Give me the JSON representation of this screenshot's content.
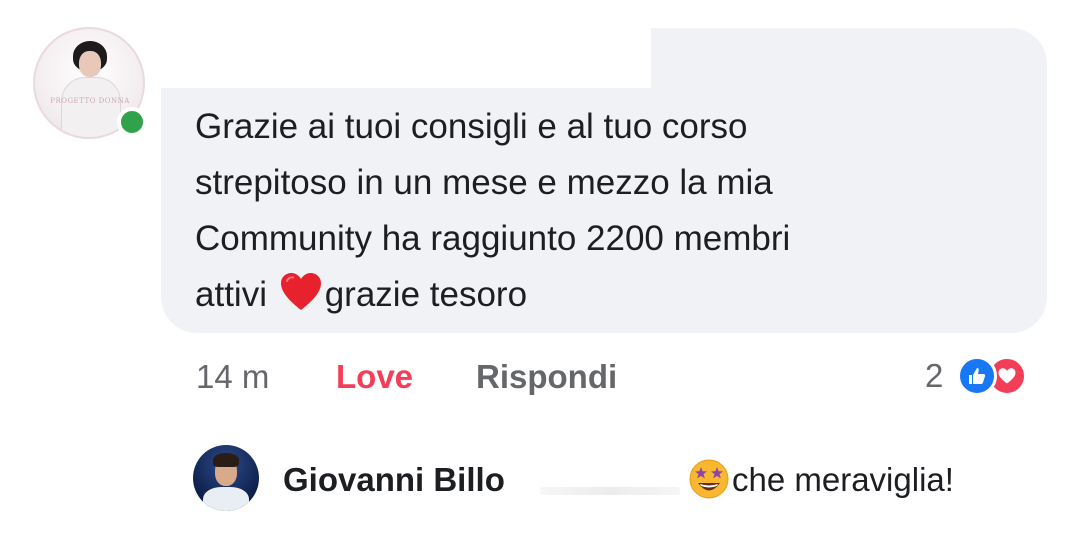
{
  "comment": {
    "author_avatar_label": "PROGETTO DONNA",
    "text_before_heart": "Grazie ai tuoi consigli e al tuo corso\nstrepitoso in un mese e mezzo la mia\nCommunity ha raggiunto 2200 membri\nattivi ",
    "text_after_heart": "grazie tesoro",
    "heart_icon": "red-heart-emoji",
    "online_status_color": "#31a24c",
    "bubble_color": "#f0f2f5"
  },
  "actions": {
    "timestamp": "14 m",
    "love_label": "Love",
    "love_color": "#f33e58",
    "reply_label": "Rispondi"
  },
  "reactions": {
    "count": "2",
    "icons": [
      "like-icon",
      "love-icon"
    ],
    "like_color": "#1877f2",
    "love_color": "#f33e58"
  },
  "reply": {
    "author": "Giovanni Billo",
    "emoji_icon": "star-struck-emoji",
    "text": "che meraviglia!"
  }
}
